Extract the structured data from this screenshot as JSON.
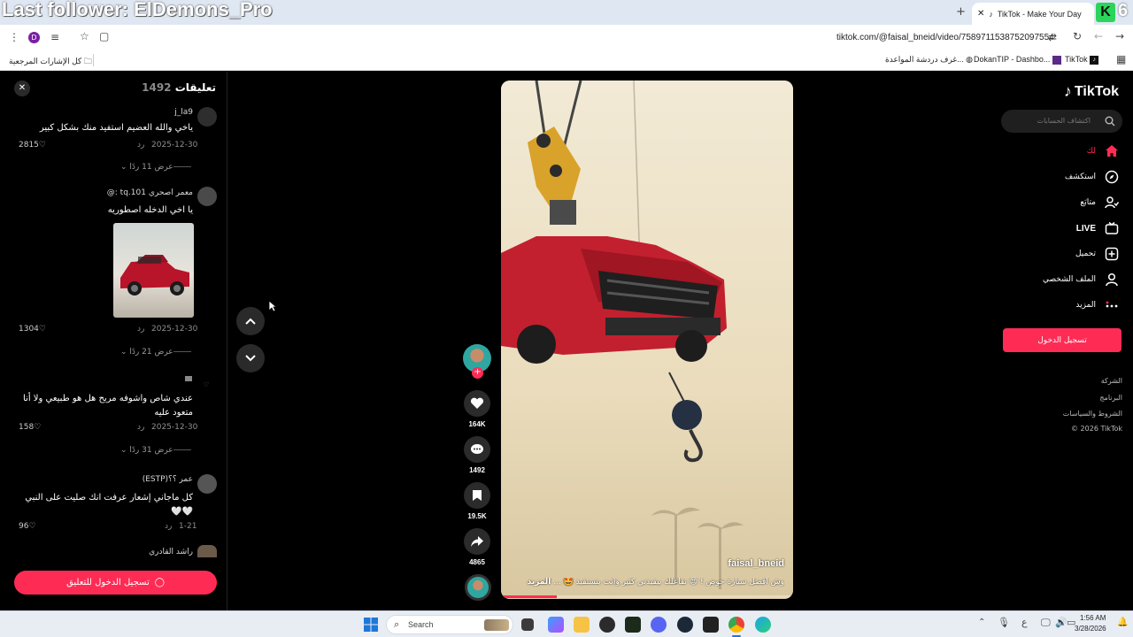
{
  "overlay_title": "Last follower: ElDemons_Pro",
  "overlay_badge": "6",
  "browser": {
    "tab_title": "TikTok - Make Your Day",
    "url": "tiktok.com/@faisal_bneid/video/7589711538752097554",
    "profile_letter": "D",
    "bookmarks": {
      "all": "كل الإشارات المرجعية",
      "chat": "غرف دردشة المواعدة...",
      "dokan": "DokanTIP - Dashbo...",
      "tiktok": "TikTok"
    }
  },
  "comments_panel": {
    "title": "تعليقات",
    "count": "1492",
    "reply_label": "رد",
    "comments": [
      {
        "user": "j_la9",
        "text": "ياخي والله العضيم استفيد منك بشكل كبير",
        "date": "2025-12-30",
        "likes": "2815",
        "view_replies": "عرض 11 ردًا"
      },
      {
        "user": "معمر اصحري 101.tq :@",
        "text": "يا اخي الدخله اصطوريه",
        "date": "2025-12-30",
        "likes": "1304",
        "view_replies": "عرض 21 ردًا"
      },
      {
        "user": "",
        "text": "عندي شاص واشوفه مريح هل هو طبيعي ولا أنا متعود عليه",
        "date": "2025-12-30",
        "likes": "158",
        "view_replies": "عرض 31 ردًا"
      },
      {
        "user": "عمر ؟؟(ESTP)",
        "text": "كل ماجاني إشعار عرفت انك صليت على النبي 🤍🤍",
        "date": "1-21",
        "likes": "96"
      },
      {
        "user": "راشد القادري"
      }
    ],
    "login_button": "تسجيل الدخول للتعليق"
  },
  "video": {
    "author": "faisal_bneid",
    "caption": "وش افضل سيارة حوض ! 😍 تفاعلك بيفيدني كثير وانت بتستفيد 🤩 ...",
    "more": "المزيد"
  },
  "actions": {
    "likes": "164K",
    "comments": "1492",
    "saves": "19.5K",
    "shares": "4865"
  },
  "sidebar": {
    "logo": "TikTok",
    "search_placeholder": "اكتشاف الحسابات",
    "items": [
      {
        "label": "لك",
        "icon": "home-icon"
      },
      {
        "label": "استكشف",
        "icon": "compass-icon"
      },
      {
        "label": "متابَع",
        "icon": "following-icon"
      },
      {
        "label": "LIVE",
        "icon": "live-icon"
      },
      {
        "label": "تحميل",
        "icon": "upload-icon"
      },
      {
        "label": "الملف الشخصي",
        "icon": "profile-icon"
      },
      {
        "label": "المزيد",
        "icon": "more-icon"
      }
    ],
    "login_button": "تسجيل الدخول",
    "footer": [
      "الشركة",
      "البرنامج",
      "الشروط والسياسات",
      "© 2026 TikTok"
    ]
  },
  "taskbar": {
    "search_placeholder": "Search",
    "time": "1:56 AM",
    "date": "3/28/2026",
    "lang": "ع"
  },
  "colors": {
    "accent": "#fe2c55",
    "overlay_green": "#2bd45a"
  }
}
